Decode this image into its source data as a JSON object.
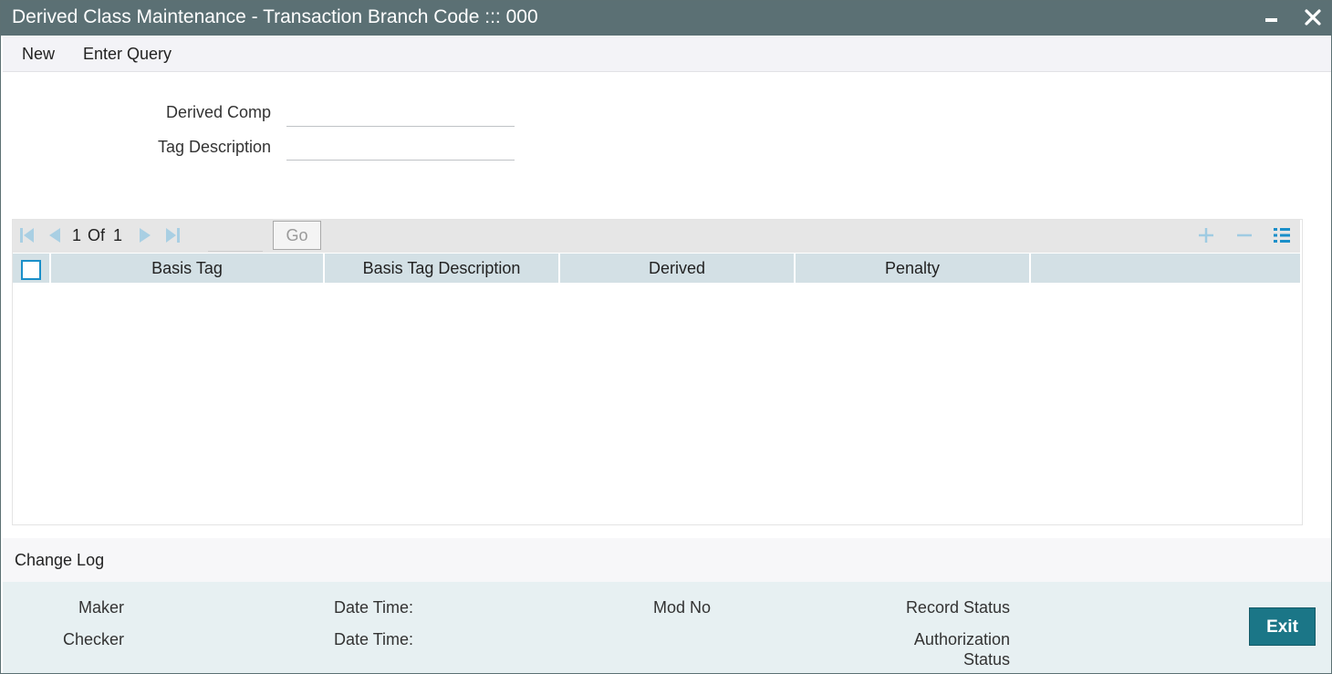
{
  "window": {
    "title": "Derived Class Maintenance - Transaction Branch Code ::: 000",
    "minimize_icon": "minimize-icon",
    "close_icon": "close-icon"
  },
  "menu": {
    "items": [
      "New",
      "Enter Query"
    ]
  },
  "form": {
    "derived_comp": {
      "label": "Derived Comp",
      "value": ""
    },
    "tag_description": {
      "label": "Tag Description",
      "value": ""
    }
  },
  "grid": {
    "pagination": {
      "current": "1",
      "of_label": "Of",
      "total": "1",
      "go_label": "Go",
      "page_value": ""
    },
    "toolbar_icons": [
      "first-page-icon",
      "previous-page-icon",
      "next-page-icon",
      "last-page-icon",
      "add-row-icon",
      "delete-row-icon",
      "single-view-icon"
    ],
    "columns": [
      "Basis Tag",
      "Basis Tag Description",
      "Derived",
      "Penalty",
      ""
    ],
    "rows": []
  },
  "change_log": {
    "title": "Change Log",
    "maker_label": "Maker",
    "checker_label": "Checker",
    "maker_date_label": "Date Time:",
    "checker_date_label": "Date Time:",
    "mod_no_label": "Mod No",
    "record_status_label": "Record Status",
    "authorization_status_label_1": "Authorization",
    "authorization_status_label_2": "Status"
  },
  "actions": {
    "exit_label": "Exit"
  },
  "colors": {
    "titlebar": "#5b7074",
    "accent": "#1b7687",
    "icon_blue": "#1a8fc9",
    "grid_header": "#d3e0e5",
    "footer": "#e7f0f2"
  }
}
